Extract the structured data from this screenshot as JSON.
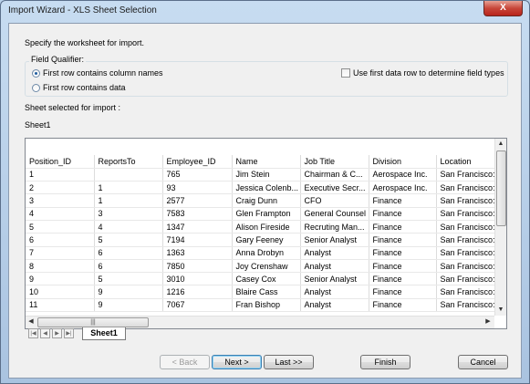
{
  "window": {
    "title": "Import Wizard - XLS Sheet Selection",
    "close_label": "X"
  },
  "instructions": "Specify the worksheet for import.",
  "field_qualifier": {
    "label": "Field Qualifier:",
    "option_column_names": "First row contains column names",
    "option_data": "First row contains data",
    "selected": "column_names",
    "use_first_data_row_label": "Use first data row to determine field types",
    "use_first_data_row_checked": false
  },
  "sheet_selected_label": "Sheet selected for import :",
  "sheet_selected_value": "Sheet1",
  "grid": {
    "columns": [
      "Position_ID",
      "ReportsTo",
      "Employee_ID",
      "Name",
      "Job Title",
      "Division",
      "Location"
    ],
    "rows": [
      [
        "1",
        "",
        "765",
        "Jim Stein",
        "Chairman & C...",
        "Aerospace Inc.",
        "San Francisco:"
      ],
      [
        "2",
        "1",
        "93",
        "Jessica Colenb...",
        "Executive Secr...",
        "Aerospace Inc.",
        "San Francisco:"
      ],
      [
        "3",
        "1",
        "2577",
        "Craig Dunn",
        "CFO",
        "Finance",
        "San Francisco:"
      ],
      [
        "4",
        "3",
        "7583",
        "Glen Frampton",
        "General Counsel",
        "Finance",
        "San Francisco:"
      ],
      [
        "5",
        "4",
        "1347",
        "Alison Fireside",
        "Recruting Man...",
        "Finance",
        "San Francisco:"
      ],
      [
        "6",
        "5",
        "7194",
        "Gary Feeney",
        "Senior Analyst",
        "Finance",
        "San Francisco:"
      ],
      [
        "7",
        "6",
        "1363",
        "Anna Drobyn",
        "Analyst",
        "Finance",
        "San Francisco:"
      ],
      [
        "8",
        "6",
        "7850",
        "Joy Crenshaw",
        "Analyst",
        "Finance",
        "San Francisco:"
      ],
      [
        "9",
        "5",
        "3010",
        "Casey Cox",
        "Senior Analyst",
        "Finance",
        "San Francisco:"
      ],
      [
        "10",
        "9",
        "1216",
        "Blaire Cass",
        "Analyst",
        "Finance",
        "San Francisco:"
      ],
      [
        "11",
        "9",
        "7067",
        "Fran Bishop",
        "Analyst",
        "Finance",
        "San Francisco:"
      ]
    ]
  },
  "sheet_tab": "Sheet1",
  "buttons": {
    "back": "< Back",
    "next": "Next >",
    "last": "Last >>",
    "finish": "Finish",
    "cancel": "Cancel"
  }
}
